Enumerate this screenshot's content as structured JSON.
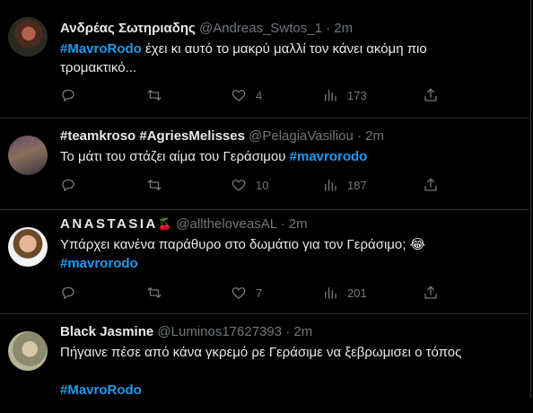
{
  "tweets": [
    {
      "name": "Ανδρέας Σωτηριαδης",
      "handle": "@Andreas_Swtos_1",
      "dot": "·",
      "time": "2m",
      "text_line1_tag": "#MavroRodo",
      "text_line1": " έχει κι αυτό το μακρύ μαλλί τον κάνει ακόμη πιο",
      "text_line2": "τρομακτικό...",
      "likes": "4",
      "views": "173"
    },
    {
      "name": "#teamkroso #AgriesMelisses",
      "handle": "@PelagiaVasiliou",
      "dot": "·",
      "time": "2m",
      "text": "Το μάτι του στάζει αίμα του Γεράσιμου ",
      "text_tag": "#mavrorodo",
      "likes": "10",
      "views": "187"
    },
    {
      "name": "ANASTASIA",
      "name_emoji": "🍒",
      "handle": "@alltheloveasAL",
      "dot": "·",
      "time": "2m",
      "text": "Υπάρχει κανένα παράθυρο στο δωμάτιο για τον Γεράσιμο; ",
      "text_emoji": "😂",
      "text_tag": "#mavrorodo",
      "likes": "7",
      "views": "201"
    },
    {
      "name": "Black Jasmine",
      "handle": "@Luminos17627393",
      "dot": "·",
      "time": "2m",
      "text": "Πήγαινε πέσε από κάνα γκρεμό ρε Γεράσιμε να ξεβρωμισει ο τόπος",
      "text_tag": "#MavroRodo"
    }
  ],
  "colors": {
    "background": "#000000",
    "text": "#e7e9ea",
    "muted": "#71767b",
    "link": "#1d9bf0",
    "border": "#2f3336"
  },
  "icons": [
    "reply-icon",
    "retweet-icon",
    "like-icon",
    "views-icon",
    "share-icon"
  ]
}
